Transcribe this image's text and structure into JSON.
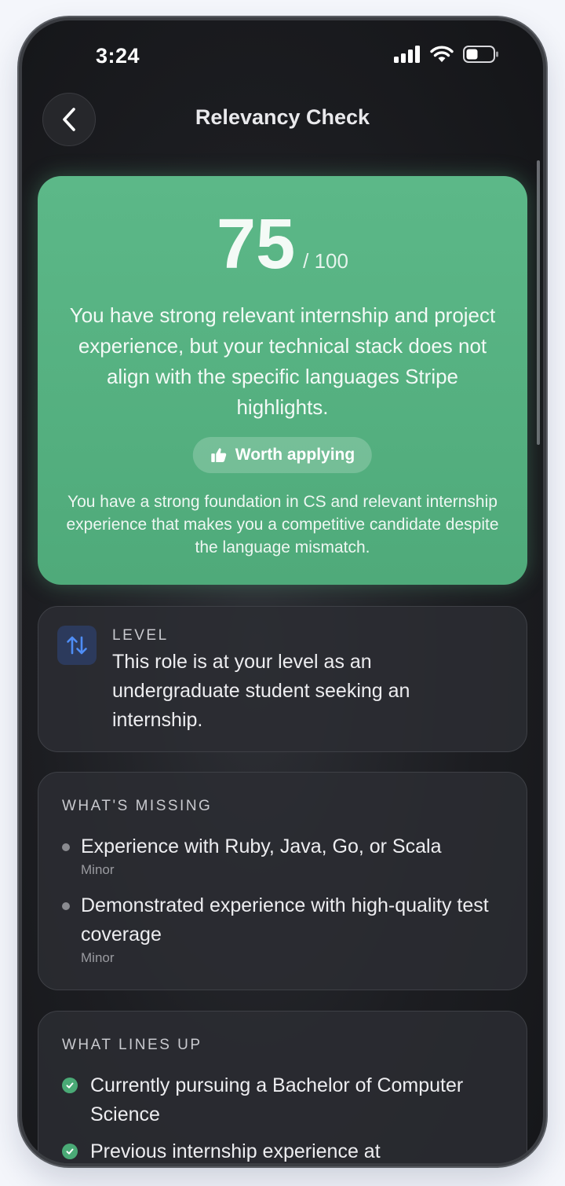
{
  "status_bar": {
    "time": "3:24",
    "icons": [
      "signal-icon",
      "wifi-icon",
      "battery-icon"
    ]
  },
  "header": {
    "title": "Relevancy Check",
    "back_icon": "chevron-left-icon"
  },
  "score": {
    "value": "75",
    "max": "/ 100",
    "summary": "You have strong relevant internship and project experience, but your technical stack does not align with the specific languages Stripe highlights.",
    "verdict": "Worth applying",
    "verdict_icon": "thumbs-up-icon",
    "verdict_reason": "You have a strong foundation in CS and relevant internship experience that makes you a competitive candidate despite the language mismatch.",
    "color": "#5cb888"
  },
  "level": {
    "label": "LEVEL",
    "text": "This role is at your level as an undergraduate student seeking an internship.",
    "icon": "sort-arrows-icon",
    "icon_color": "#4f8df5"
  },
  "missing": {
    "label": "WHAT'S MISSING",
    "items": [
      {
        "text": "Experience with Ruby, Java, Go, or Scala",
        "severity": "Minor"
      },
      {
        "text": "Demonstrated experience with high-quality test coverage",
        "severity": "Minor"
      }
    ]
  },
  "lines_up": {
    "label": "WHAT LINES UP",
    "items": [
      {
        "text": "Currently pursuing a Bachelor of Computer Science"
      },
      {
        "text": "Previous internship experience at"
      }
    ],
    "check_color": "#4aaa76"
  }
}
